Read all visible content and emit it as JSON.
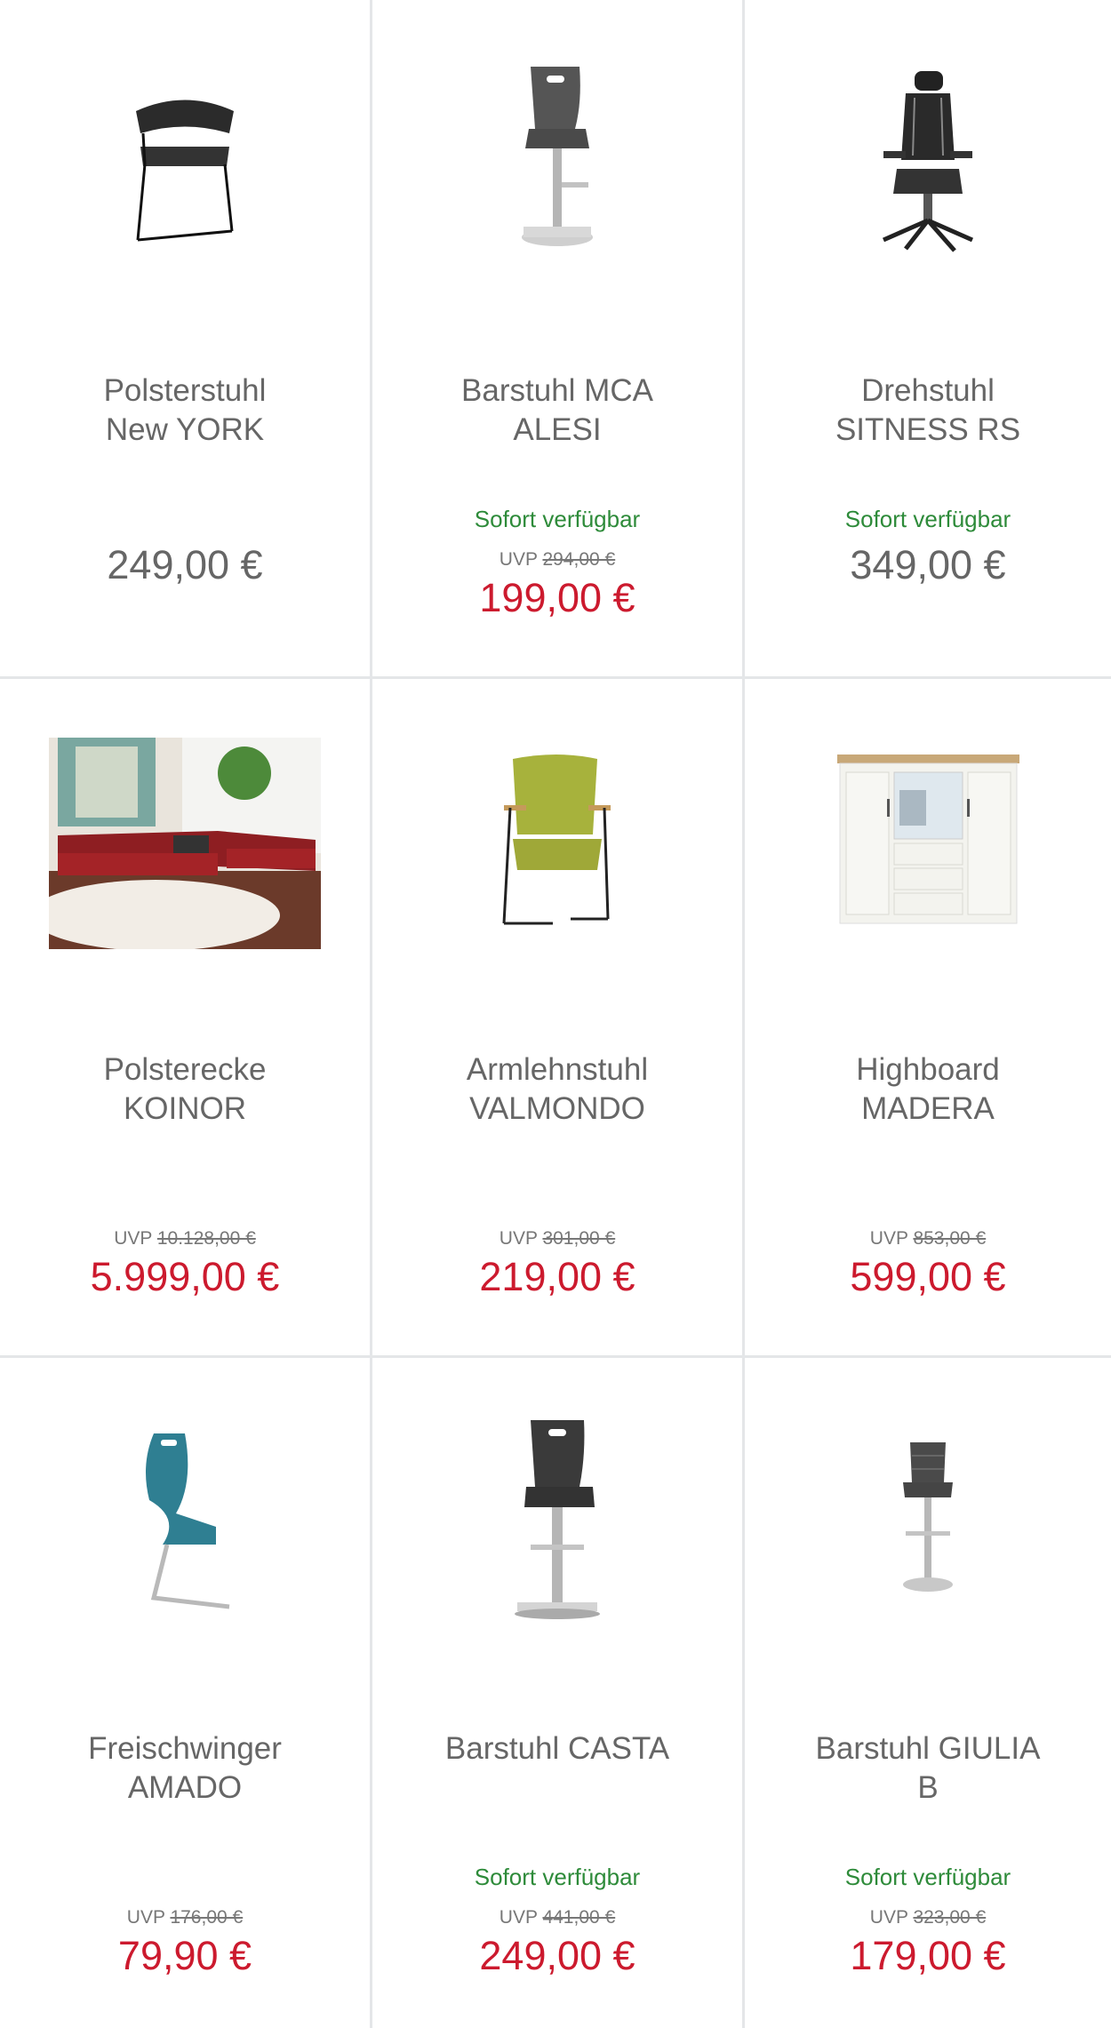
{
  "labels": {
    "uvp": "UVP"
  },
  "colors": {
    "sale_price": "#cc1a2e",
    "regular_price": "#666666",
    "availability": "#2e8b3a",
    "divider": "#e4e6e8"
  },
  "products": [
    {
      "name_line1": "Polsterstuhl",
      "name_line2": "New YORK",
      "availability": "",
      "uvp": "",
      "price": "249,00 €",
      "image": "black-chair-icon"
    },
    {
      "name_line1": "Barstuhl MCA",
      "name_line2": "ALESI",
      "availability": "Sofort verfügbar",
      "uvp": "294,00 €",
      "price": "199,00 €",
      "image": "bar-stool-icon"
    },
    {
      "name_line1": "Drehstuhl",
      "name_line2": "SITNESS RS",
      "availability": "Sofort verfügbar",
      "uvp": "",
      "price": "349,00 €",
      "image": "office-chair-icon"
    },
    {
      "name_line1": "Polsterecke",
      "name_line2": "KOINOR",
      "availability": "",
      "uvp": "10.128,00 €",
      "price": "5.999,00 €",
      "image": "sofa-photo"
    },
    {
      "name_line1": "Armlehnstuhl",
      "name_line2": "VALMONDO",
      "availability": "",
      "uvp": "301,00 €",
      "price": "219,00 €",
      "image": "armchair-icon"
    },
    {
      "name_line1": "Highboard",
      "name_line2": "MADERA",
      "availability": "",
      "uvp": "853,00 €",
      "price": "599,00 €",
      "image": "highboard-icon"
    },
    {
      "name_line1": "Freischwinger",
      "name_line2": "AMADO",
      "availability": "",
      "uvp": "176,00 €",
      "price": "79,90 €",
      "image": "cantilever-chair-icon"
    },
    {
      "name_line1": "Barstuhl CASTA",
      "name_line2": "",
      "availability": "Sofort verfügbar",
      "uvp": "441,00 €",
      "price": "249,00 €",
      "image": "bar-stool-icon"
    },
    {
      "name_line1": "Barstuhl GIULIA",
      "name_line2": "B",
      "availability": "Sofort verfügbar",
      "uvp": "323,00 €",
      "price": "179,00 €",
      "image": "bar-stool-icon"
    }
  ]
}
